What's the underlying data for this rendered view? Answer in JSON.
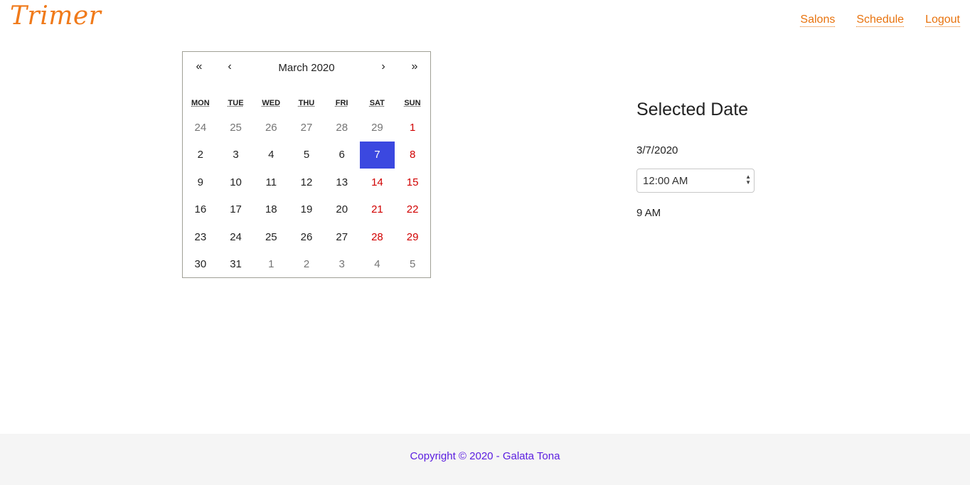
{
  "header": {
    "logo": "Trimer",
    "nav": [
      "Salons",
      "Schedule",
      "Logout"
    ],
    "accent": "#e8730e"
  },
  "calendar": {
    "prev_year": "«",
    "prev_month": "‹",
    "month_label": "March 2020",
    "next_month": "›",
    "next_year": "»",
    "weekdays": [
      "MON",
      "TUE",
      "WED",
      "THU",
      "FRI",
      "SAT",
      "SUN"
    ],
    "days": [
      {
        "label": "24",
        "type": "other"
      },
      {
        "label": "25",
        "type": "other"
      },
      {
        "label": "26",
        "type": "other"
      },
      {
        "label": "27",
        "type": "other"
      },
      {
        "label": "28",
        "type": "other"
      },
      {
        "label": "29",
        "type": "other"
      },
      {
        "label": "1",
        "type": "weekend"
      },
      {
        "label": "2",
        "type": "normal"
      },
      {
        "label": "3",
        "type": "normal"
      },
      {
        "label": "4",
        "type": "normal"
      },
      {
        "label": "5",
        "type": "normal"
      },
      {
        "label": "6",
        "type": "normal"
      },
      {
        "label": "7",
        "type": "selected"
      },
      {
        "label": "8",
        "type": "weekend"
      },
      {
        "label": "9",
        "type": "normal"
      },
      {
        "label": "10",
        "type": "normal"
      },
      {
        "label": "11",
        "type": "normal"
      },
      {
        "label": "12",
        "type": "normal"
      },
      {
        "label": "13",
        "type": "normal"
      },
      {
        "label": "14",
        "type": "weekend"
      },
      {
        "label": "15",
        "type": "weekend"
      },
      {
        "label": "16",
        "type": "normal"
      },
      {
        "label": "17",
        "type": "normal"
      },
      {
        "label": "18",
        "type": "normal"
      },
      {
        "label": "19",
        "type": "normal"
      },
      {
        "label": "20",
        "type": "normal"
      },
      {
        "label": "21",
        "type": "weekend"
      },
      {
        "label": "22",
        "type": "weekend"
      },
      {
        "label": "23",
        "type": "normal"
      },
      {
        "label": "24",
        "type": "normal"
      },
      {
        "label": "25",
        "type": "normal"
      },
      {
        "label": "26",
        "type": "normal"
      },
      {
        "label": "27",
        "type": "normal"
      },
      {
        "label": "28",
        "type": "weekend"
      },
      {
        "label": "29",
        "type": "weekend"
      },
      {
        "label": "30",
        "type": "normal"
      },
      {
        "label": "31",
        "type": "normal"
      },
      {
        "label": "1",
        "type": "other"
      },
      {
        "label": "2",
        "type": "other"
      },
      {
        "label": "3",
        "type": "other"
      },
      {
        "label": "4",
        "type": "other"
      },
      {
        "label": "5",
        "type": "other"
      }
    ],
    "selected_color": "#3b48e0",
    "weekend_color": "#d10000"
  },
  "selected": {
    "title": "Selected Date",
    "date": "3/7/2020",
    "time_select_value": "12:00 AM",
    "time": "9 AM"
  },
  "footer": {
    "copyright": "Copyright © 2020 - Galata Tona"
  }
}
